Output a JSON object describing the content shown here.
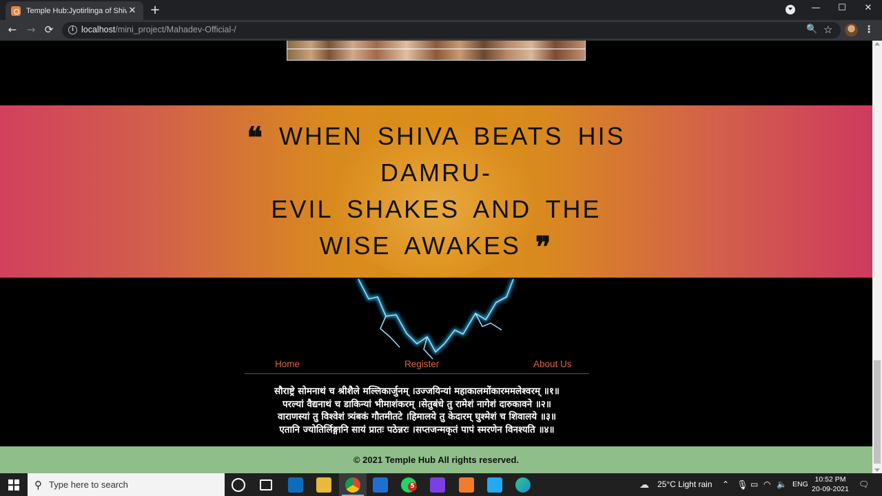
{
  "browser": {
    "tab_title": "Temple Hub:Jyotirlinga of Shiva",
    "tab_close": "✕",
    "new_tab": "+",
    "url_host": "localhost",
    "url_path": "/mini_project/Mahadev-Official-/",
    "min": "—",
    "max": "☐",
    "close": "✕",
    "back": "←",
    "forward": "→",
    "reload": "⟳",
    "info": "i",
    "zoom": "🔍",
    "star": "☆",
    "menu": "⋮"
  },
  "banner": {
    "quote_line1": "WHEN SHIVA BEATS HIS DAMRU-",
    "quote_line2": "EVIL SHAKES AND THE WISE AWAKES",
    "open_mark": "❝",
    "close_mark": "❞"
  },
  "nav": {
    "home": "Home",
    "register": "Register",
    "about": "About Us"
  },
  "shloka": [
    "सौराष्ट्रे सोमनाथं च श्रीशैले मल्लिकार्जुनम् ।उज्जयिन्यां महाकालमोंकारममलेश्वरम् ॥१॥",
    "परल्यां वैद्यनाथं च डाकिन्यां भीमाशंकरम् ।सेतुबंधे तु रामेशं नागेशं दारुकावने ॥२॥",
    "वाराणस्यां तु विश्वेशं त्र्यंबकं गौतमीतटे ।हिमालये तु केदारम् घुश्मेशं च शिवालये ॥३॥",
    "एतानि ज्योतिर्लिङ्गानि सायं प्रातः पठेन्नरः ।सप्तजन्मकृतं पापं स्मरणेन विनश्यति ॥४॥"
  ],
  "footer": {
    "copyright": "© 2021 Temple Hub All rights reserved."
  },
  "taskbar": {
    "search_placeholder": "Type here to search",
    "whatsapp_badge": "5",
    "weather": "25°C  Light rain",
    "lang": "ENG",
    "time": "10:52 PM",
    "date": "20-09-2021"
  },
  "colors": {
    "nav_link": "#e0653a",
    "footer_bg": "#8fbe8a",
    "banner_center": "#db8e18",
    "banner_edge": "#d2405e"
  }
}
